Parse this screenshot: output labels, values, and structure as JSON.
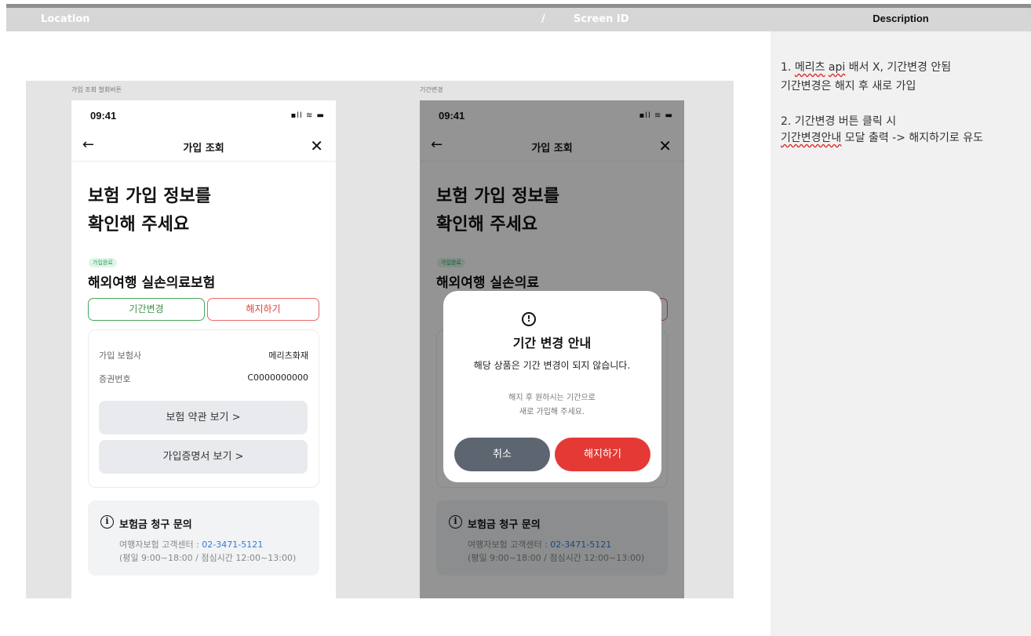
{
  "header": {
    "location_label": "Location",
    "slash": "/",
    "screen_id_label": "Screen ID",
    "description_label": "Description"
  },
  "description": {
    "line1": "1. 메리츠 api 배서 X, 기간변경 안됨",
    "line1_prefix": "1. ",
    "line1_squiggle1": "메리츠",
    "line1_mid": " ",
    "line1_squiggle2": "api",
    "line1_suffix": " 배서 X, 기간변경 안됨",
    "line2": "기간변경은 해지 후 새로 가입",
    "line3": "2. 기간변경 버튼 클릭 시",
    "line4_a": "기간변경안내",
    "line4_b": " 모달 출력 -> 해지하기로 유도"
  },
  "captions": {
    "screen1": "가입 조회 철회버튼",
    "screen2": "기간변경"
  },
  "phone": {
    "time": "09:41",
    "status_icons": "signal-wifi-battery",
    "status_glyphs": "▪ll ≋ ▬",
    "back_glyph": "←",
    "nav_title": "가입 조회",
    "close_glyph": "✕",
    "headline_1": "보험 가입 정보를",
    "headline_2": "확인해 주세요",
    "badge": "가입완료",
    "product_name": "해외여행 실손의료보험",
    "product_name_cut": "해외여행 실손의료",
    "btn_change": "기간변경",
    "btn_cancel": "해지하기",
    "row1_label": "가입 보험사",
    "row1_value": "메리츠화재",
    "row2_label": "증권번호",
    "row2_value": "C0000000000",
    "btn_terms": "보험 약관 보기  >",
    "btn_cert": "가입증명서 보기  >",
    "info_icon_glyph": "i",
    "info_title": "보험금 청구 문의",
    "info_line1_prefix": "여행자보험 고객센터 : ",
    "info_phone": "02-3471-5121",
    "info_line2": "(평일 9:00~18:00 / 점심시간 12:00~13:00)"
  },
  "modal": {
    "icon_glyph": "!",
    "title": "기간 변경 안내",
    "desc": "해당 상품은 기간 변경이 되지 않습니다.",
    "sub1": "해지 후 원하시는 기간으로",
    "sub2": "새로 가입해 주세요.",
    "cancel": "취소",
    "confirm": "해지하기"
  },
  "colors": {
    "accent_green": "#4aa65a",
    "accent_red": "#e53935",
    "link_blue": "#2d7cd6"
  }
}
